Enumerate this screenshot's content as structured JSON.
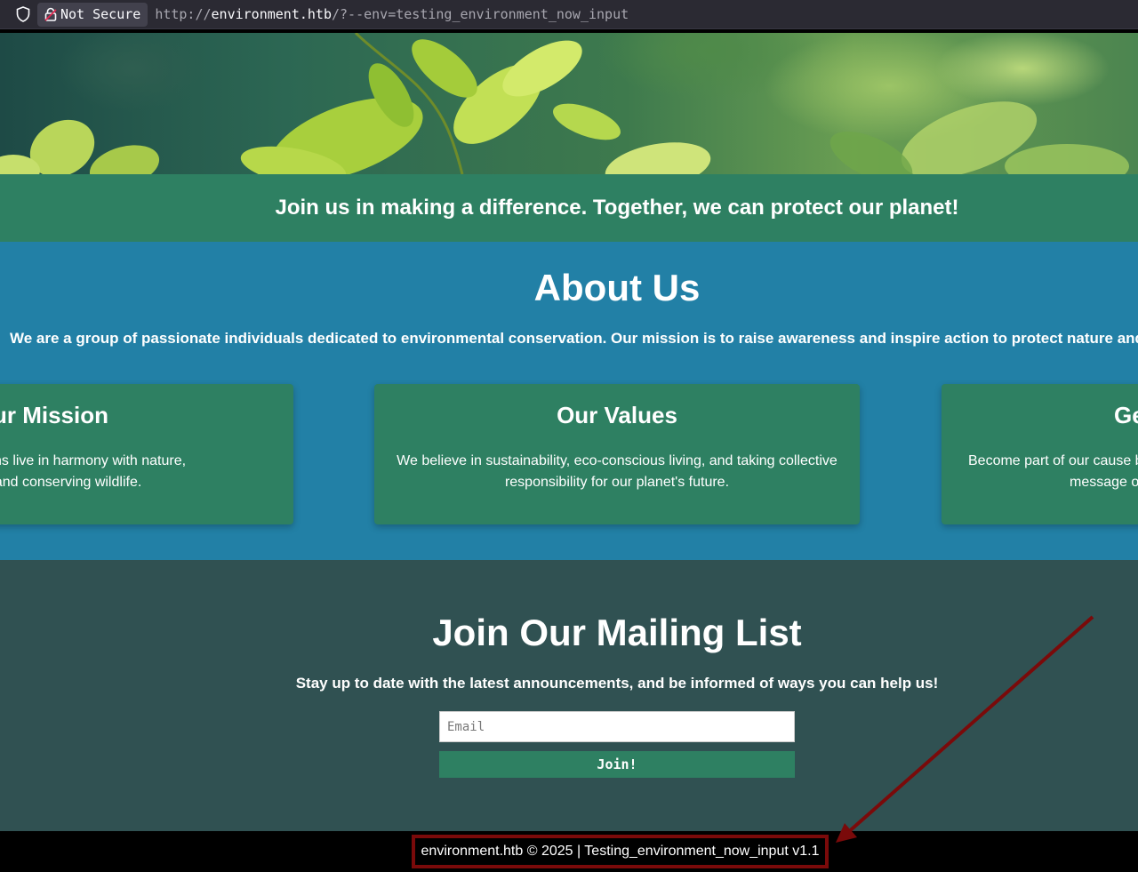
{
  "browser": {
    "security_label": "Not Secure",
    "url_scheme": "http://",
    "url_host": "environment.htb",
    "url_path": "/?--env=testing_environment_now_input",
    "icons": [
      "shield-icon",
      "lock-icon"
    ]
  },
  "banner": {
    "text": "Join us in making a difference. Together, we can protect our planet!"
  },
  "about": {
    "title": "About Us",
    "description": "We are a group of passionate individuals dedicated to environmental conservation. Our mission is to raise awareness and inspire action to protect nature and its e",
    "cards": [
      {
        "title": "ur Mission",
        "line1": "where humans live in harmony with nature,",
        "line2": "ution and conserving wildlife."
      },
      {
        "title": "Our Values",
        "line1": "We believe in sustainability, eco-conscious living, and taking collective",
        "line2": "responsibility for our planet's future."
      },
      {
        "title": "Ge",
        "line1": "Become part of our cause b",
        "line2": "message of"
      }
    ]
  },
  "mailing": {
    "title": "Join Our Mailing List",
    "subtitle": "Stay up to date with the latest announcements, and be informed of ways you can help us!",
    "email_placeholder": "Email",
    "email_value": "",
    "join_label": "Join!"
  },
  "footer": {
    "text": "environment.htb © 2025 | Testing_environment_now_input v1.1"
  },
  "colors": {
    "banner": "#2e8062",
    "about_bg": "#2280a6",
    "mailing_bg": "#305152",
    "annotation": "#7a0a0a"
  }
}
